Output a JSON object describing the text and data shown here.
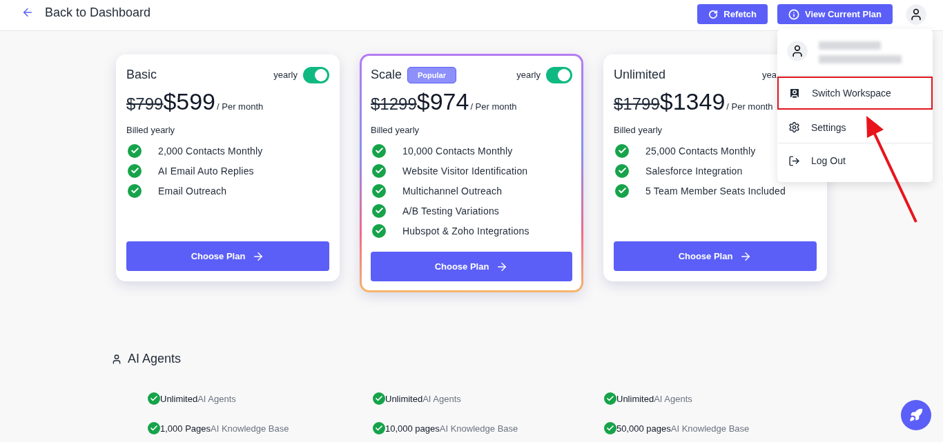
{
  "header": {
    "back_label": "Back to Dashboard",
    "buttons": [
      {
        "label": "Refetch",
        "kind": "refresh"
      },
      {
        "label": "View Current Plan",
        "kind": "info"
      }
    ]
  },
  "plans": [
    {
      "name": "Basic",
      "toggle": {
        "label": "yearly",
        "on": true
      },
      "old_price": "$799",
      "price": "$599",
      "period": "/ Per month",
      "billing": "Billed yearly",
      "features": [
        "2,000 Contacts Monthly",
        "AI Email Auto Replies",
        "Email Outreach"
      ],
      "cta": "Choose Plan",
      "featured": false
    },
    {
      "name": "Scale",
      "badge": "Popular",
      "toggle": {
        "label": "yearly",
        "on": true
      },
      "old_price": "$1299",
      "price": "$974",
      "period": "/ Per month",
      "billing": "Billed yearly",
      "features": [
        "10,000 Contacts Monthly",
        "Website Visitor Identification",
        "Multichannel Outreach",
        "A/B Testing Variations",
        "Hubspot & Zoho Integrations"
      ],
      "cta": "Choose Plan",
      "featured": true
    },
    {
      "name": "Unlimited",
      "toggle": {
        "label": "yea"
      },
      "old_price": "$1799",
      "price": "$1349",
      "period": "/ Per month",
      "billing": "Billed yearly",
      "features": [
        "25,000 Contacts Monthly",
        "Salesforce Integration",
        "5 Team Member Seats Included"
      ],
      "cta": "Choose Plan",
      "featured": false
    }
  ],
  "ai_agents": {
    "title": "AI Agents",
    "rows": [
      [
        {
          "value": "Unlimited",
          "label": "AI Agents"
        },
        {
          "value": "Unlimited",
          "label": "AI Agents"
        },
        {
          "value": "Unlimited",
          "label": "AI Agents"
        }
      ],
      [
        {
          "value": "1,000 Pages",
          "label": "AI Knowledge Base"
        },
        {
          "value": "10,000 pages",
          "label": "AI Knowledge Base"
        },
        {
          "value": "50,000 pages",
          "label": "AI Knowledge Base"
        }
      ]
    ]
  },
  "user_menu": {
    "expanded": true,
    "items": [
      {
        "label": "Switch Workspace",
        "kind": "workspace",
        "annotated": true
      },
      {
        "label": "Settings",
        "kind": "settings",
        "annotated": false
      },
      {
        "label": "Log Out",
        "kind": "logout",
        "annotated": false
      }
    ]
  }
}
